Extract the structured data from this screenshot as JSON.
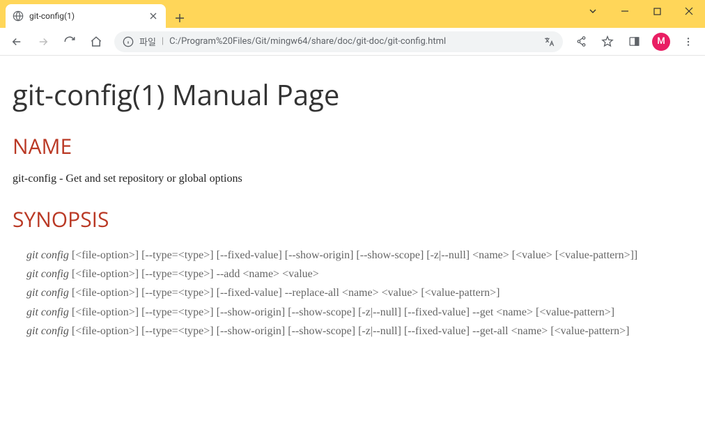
{
  "tab": {
    "title": "git-config(1)"
  },
  "omnibox": {
    "prefix_label": "파일",
    "url": "C:/Program%20Files/Git/mingw64/share/doc/git-doc/git-config.html"
  },
  "avatar": {
    "initial": "M"
  },
  "page": {
    "h1": "git-config(1) Manual Page",
    "name_heading": "NAME",
    "name_text": "git-config - Get and set repository or global options",
    "synopsis_heading": "SYNOPSIS",
    "synopsis": [
      {
        "cmd": "git config",
        "rest": " [<file-option>] [--type=<type>] [--fixed-value] [--show-origin] [--show-scope] [-z|--null] <name> [<value> [<value-pattern>]]"
      },
      {
        "cmd": "git config",
        "rest": " [<file-option>] [--type=<type>] --add <name> <value>"
      },
      {
        "cmd": "git config",
        "rest": " [<file-option>] [--type=<type>] [--fixed-value] --replace-all <name> <value> [<value-pattern>]"
      },
      {
        "cmd": "git config",
        "rest": " [<file-option>] [--type=<type>] [--show-origin] [--show-scope] [-z|--null] [--fixed-value] --get <name> [<value-pattern>]"
      },
      {
        "cmd": "git config",
        "rest": " [<file-option>] [--type=<type>] [--show-origin] [--show-scope] [-z|--null] [--fixed-value] --get-all <name> [<value-pattern>]"
      }
    ]
  }
}
